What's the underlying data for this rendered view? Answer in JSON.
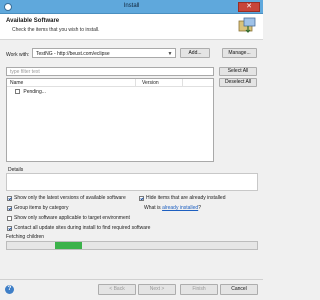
{
  "window": {
    "title": "Install",
    "close_glyph": "✕"
  },
  "header": {
    "title": "Available Software",
    "description": "Check the items that you wish to install.",
    "icon": "install-wizard-icon"
  },
  "work_with": {
    "label": "Work with:",
    "value": "TestNG - http://beust.com/eclipse",
    "add_label": "Add...",
    "manage_label": "Manage..."
  },
  "filter": {
    "placeholder": "type filter text"
  },
  "buttons": {
    "select_all": "Select All",
    "deselect_all": "Deselect All"
  },
  "table": {
    "columns": [
      "Name",
      "Version"
    ],
    "rows": [
      {
        "name": "Pending...",
        "checked": false
      }
    ]
  },
  "details": {
    "label": "Details"
  },
  "options": {
    "latest_versions": {
      "label": "Show only the latest versions of available software",
      "checked": true
    },
    "hide_installed": {
      "label": "Hide items that are already installed",
      "checked": true
    },
    "group_by_category": {
      "label": "Group items by category",
      "checked": true
    },
    "what_is_prefix": "What is ",
    "already_installed_link": "already installed",
    "what_is_suffix": "?",
    "target_env": {
      "label": "Show only software applicable to target environment",
      "checked": false
    },
    "contact_sites": {
      "label": "Contact all update sites during install to find required software",
      "checked": true
    }
  },
  "status": {
    "text": "Fetching children",
    "progress_fraction": 0.11
  },
  "footer": {
    "help_glyph": "?",
    "back": "< Back",
    "next": "Next >",
    "finish": "Finish",
    "cancel": "Cancel"
  },
  "colors": {
    "titlebar": "#5fa8dc",
    "progress": "#3bb24a",
    "link": "#1d5fc0"
  }
}
